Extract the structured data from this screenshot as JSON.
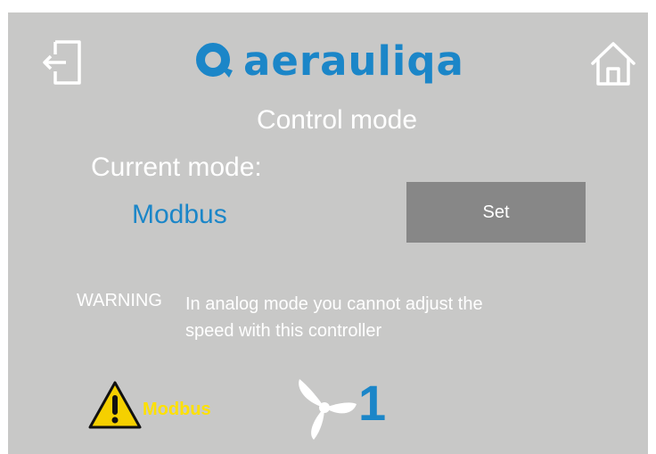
{
  "header": {
    "brand": "aerauliqa",
    "exit_icon": "exit-icon",
    "home_icon": "home-icon"
  },
  "page": {
    "title": "Control mode",
    "current_mode_label": "Current mode:",
    "current_mode_value": "Modbus",
    "set_button_label": "Set"
  },
  "warning": {
    "label": "WARNING",
    "text": "In analog mode you cannot adjust the speed with this controller"
  },
  "status_bar": {
    "alert_icon": "warning-triangle-icon",
    "mode": "Modbus",
    "fan_icon": "fan-icon",
    "fan_speed": "1"
  },
  "colors": {
    "background": "#c8c8c7",
    "accent": "#1b86c8",
    "button": "#878787",
    "status_text": "#ffe100",
    "warning_fill": "#f5d000"
  }
}
